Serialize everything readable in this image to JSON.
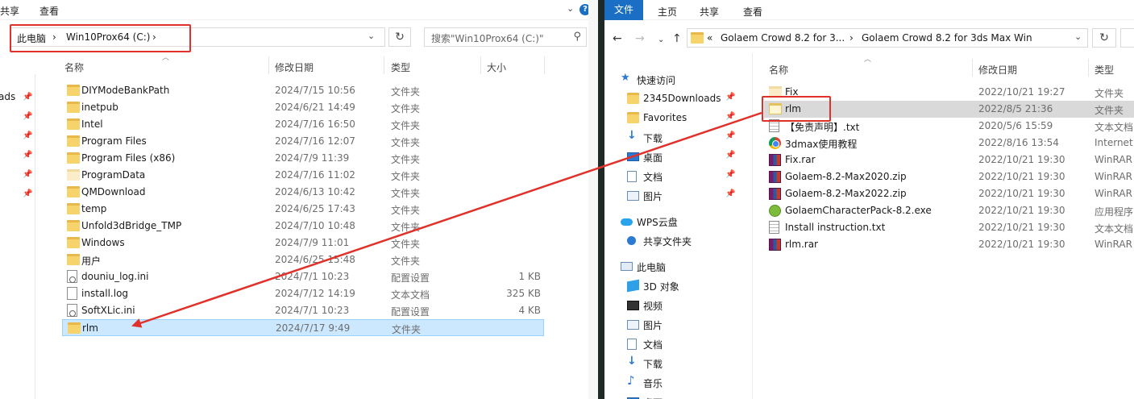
{
  "left": {
    "ribbon": {
      "share": "共享",
      "view": "查看"
    },
    "breadcrumb": {
      "this_pc": "此电脑",
      "drive": "Win10Prox64 (C:)"
    },
    "search_placeholder": "搜索\"Win10Prox64 (C:)\"",
    "stub_label": "ads",
    "columns": {
      "name": "名称",
      "date": "修改日期",
      "type": "类型",
      "size": "大小"
    },
    "rows": [
      {
        "name": "DIYModeBankPath",
        "date": "2024/7/15 10:56",
        "type": "文件夹",
        "size": "",
        "icon": "folder"
      },
      {
        "name": "inetpub",
        "date": "2024/6/21 14:49",
        "type": "文件夹",
        "size": "",
        "icon": "folder"
      },
      {
        "name": "Intel",
        "date": "2024/7/16 16:50",
        "type": "文件夹",
        "size": "",
        "icon": "folder"
      },
      {
        "name": "Program Files",
        "date": "2024/7/16 12:07",
        "type": "文件夹",
        "size": "",
        "icon": "folder"
      },
      {
        "name": "Program Files (x86)",
        "date": "2024/7/9 11:39",
        "type": "文件夹",
        "size": "",
        "icon": "folder"
      },
      {
        "name": "ProgramData",
        "date": "2024/7/16 11:02",
        "type": "文件夹",
        "size": "",
        "icon": "folder-faint"
      },
      {
        "name": "QMDownload",
        "date": "2024/6/13 10:42",
        "type": "文件夹",
        "size": "",
        "icon": "folder"
      },
      {
        "name": "temp",
        "date": "2024/6/25 17:43",
        "type": "文件夹",
        "size": "",
        "icon": "folder"
      },
      {
        "name": "Unfold3dBridge_TMP",
        "date": "2024/7/10 10:48",
        "type": "文件夹",
        "size": "",
        "icon": "folder"
      },
      {
        "name": "Windows",
        "date": "2024/7/9 11:01",
        "type": "文件夹",
        "size": "",
        "icon": "folder"
      },
      {
        "name": "用户",
        "date": "2024/6/25 15:48",
        "type": "文件夹",
        "size": "",
        "icon": "folder"
      },
      {
        "name": "douniu_log.ini",
        "date": "2024/7/1 10:23",
        "type": "配置设置",
        "size": "1 KB",
        "icon": "gear-file"
      },
      {
        "name": "install.log",
        "date": "2024/7/12 14:19",
        "type": "文本文档",
        "size": "325 KB",
        "icon": "file"
      },
      {
        "name": "SoftXLic.ini",
        "date": "2024/7/1 10:23",
        "type": "配置设置",
        "size": "4 KB",
        "icon": "gear-file"
      },
      {
        "name": "rlm",
        "date": "2024/7/17 9:49",
        "type": "文件夹",
        "size": "",
        "icon": "folder"
      }
    ]
  },
  "right": {
    "ribbon": {
      "file": "文件",
      "home": "主页",
      "share": "共享",
      "view": "查看"
    },
    "breadcrumb": {
      "prefix": "«",
      "parent": "Golaem Crowd 8.2 for 3...",
      "current": "Golaem Crowd 8.2 for 3ds Max Win"
    },
    "columns": {
      "name": "名称",
      "date": "修改日期",
      "type": "类型"
    },
    "nav": [
      {
        "label": "快速访问",
        "icon": "star",
        "pin": false,
        "indent": 0
      },
      {
        "label": "2345Downloads",
        "icon": "folder",
        "pin": true,
        "indent": 1
      },
      {
        "label": "Favorites",
        "icon": "folder",
        "pin": true,
        "indent": 1
      },
      {
        "label": "下载",
        "icon": "download",
        "pin": true,
        "indent": 1
      },
      {
        "label": "桌面",
        "icon": "desktop",
        "pin": true,
        "indent": 1
      },
      {
        "label": "文档",
        "icon": "document",
        "pin": true,
        "indent": 1
      },
      {
        "label": "图片",
        "icon": "picture",
        "pin": true,
        "indent": 1
      },
      {
        "label": "WPS云盘",
        "icon": "cloud",
        "pin": false,
        "indent": 0
      },
      {
        "label": "共享文件夹",
        "icon": "share",
        "pin": false,
        "indent": 1
      },
      {
        "label": "此电脑",
        "icon": "pc",
        "pin": false,
        "indent": 0
      },
      {
        "label": "3D 对象",
        "icon": "cube",
        "pin": false,
        "indent": 1
      },
      {
        "label": "视频",
        "icon": "video",
        "pin": false,
        "indent": 1
      },
      {
        "label": "图片",
        "icon": "picture",
        "pin": false,
        "indent": 1
      },
      {
        "label": "文档",
        "icon": "document",
        "pin": false,
        "indent": 1
      },
      {
        "label": "下载",
        "icon": "download",
        "pin": false,
        "indent": 1
      },
      {
        "label": "音乐",
        "icon": "music",
        "pin": false,
        "indent": 1
      },
      {
        "label": "桌面",
        "icon": "desktop",
        "pin": false,
        "indent": 1
      }
    ],
    "rows": [
      {
        "name": "Fix",
        "date": "2022/10/21 19:27",
        "type": "文件夹",
        "icon": "folder-faint"
      },
      {
        "name": "rlm",
        "date": "2022/8/5 21:36",
        "type": "文件夹",
        "icon": "folder-outline"
      },
      {
        "name": "【免责声明】.txt",
        "date": "2020/5/6 15:59",
        "type": "文本文档",
        "icon": "txt"
      },
      {
        "name": "3dmax使用教程",
        "date": "2022/8/16 13:54",
        "type": "Internet",
        "icon": "chrome"
      },
      {
        "name": "Fix.rar",
        "date": "2022/10/21 19:30",
        "type": "WinRAR",
        "icon": "rar"
      },
      {
        "name": "Golaem-8.2-Max2020.zip",
        "date": "2022/10/21 19:30",
        "type": "WinRAR",
        "icon": "rar"
      },
      {
        "name": "Golaem-8.2-Max2022.zip",
        "date": "2022/10/21 19:30",
        "type": "WinRAR",
        "icon": "rar"
      },
      {
        "name": "GolaemCharacterPack-8.2.exe",
        "date": "2022/10/21 19:30",
        "type": "应用程序",
        "icon": "exe"
      },
      {
        "name": "Install instruction.txt",
        "date": "2022/10/21 19:30",
        "type": "文本文档",
        "icon": "txt"
      },
      {
        "name": "rlm.rar",
        "date": "2022/10/21 19:30",
        "type": "WinRAR",
        "icon": "rar"
      }
    ]
  },
  "colors": {
    "annotation": "#e0312b",
    "selection": "#cce8ff",
    "accent": "#1a6fc4"
  }
}
